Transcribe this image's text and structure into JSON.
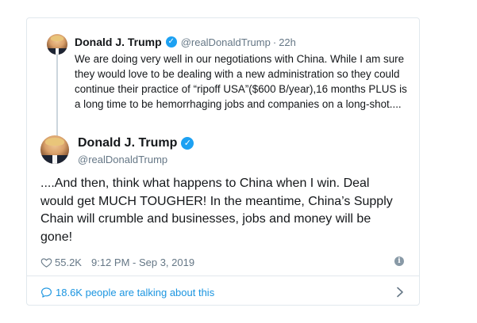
{
  "quoted_tweet": {
    "author_name": "Donald J. Trump",
    "author_handle": "@realDonaldTrump",
    "separator": "·",
    "time": "22h",
    "text": "We are doing very well in our negotiations with China. While I am sure they would love to be dealing with a new administration so they could continue their practice of “ripoff USA”($600 B/year),16 months PLUS is a long time to be hemorrhaging jobs and companies on a long-shot...."
  },
  "main_tweet": {
    "author_name": "Donald J. Trump",
    "author_handle": "@realDonaldTrump",
    "text": "....And then, think what happens to China when I win. Deal would get MUCH TOUGHER! In the meantime, China’s Supply Chain will crumble and businesses, jobs and money will be gone!",
    "likes": "55.2K",
    "timestamp": "9:12 PM - Sep 3, 2019"
  },
  "footer": {
    "conversation_text": "18.6K people are talking about this"
  },
  "colors": {
    "verified_blue": "#1da1f2",
    "link_blue": "#1b95e0",
    "secondary_gray": "#657786",
    "border": "#e1e8ed"
  },
  "icons": [
    "verified-badge-icon",
    "heart-icon",
    "info-icon",
    "speech-bubble-icon",
    "chevron-right-icon"
  ]
}
